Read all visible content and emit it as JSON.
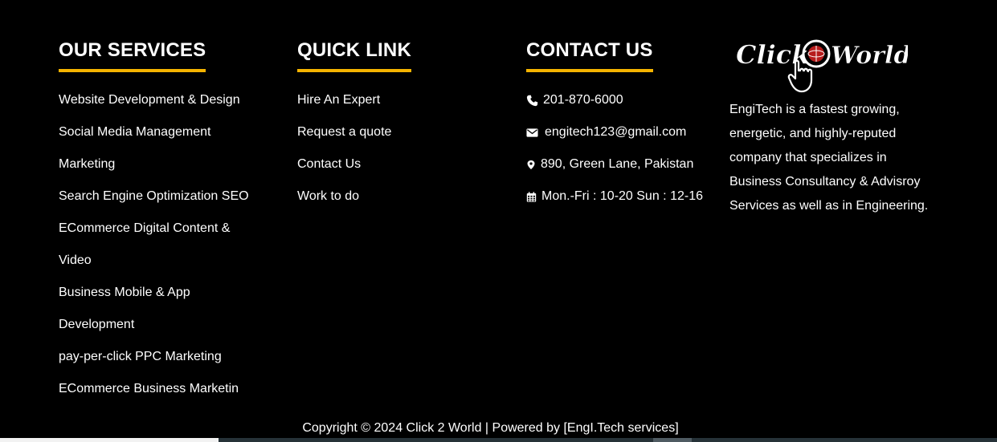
{
  "accent_color": "#f5b400",
  "background_color": "#000000",
  "services": {
    "heading": "OUR SERVICES",
    "items": [
      "Website Development & Design",
      "Social Media Management",
      "Marketing",
      "Search Engine Optimization SEO",
      "ECommerce Digital Content &",
      "Video",
      "Business Mobile & App",
      "Development",
      "pay-per-click PPC Marketing",
      "ECommerce Business Marketin"
    ]
  },
  "quick_links": {
    "heading": "QUICK LINK",
    "items": [
      "Hire An Expert",
      "Request a quote",
      "Contact Us",
      "Work to do"
    ]
  },
  "contact": {
    "heading": "CONTACT US",
    "phone": {
      "icon": "phone-icon",
      "text": "201-870-6000"
    },
    "email": {
      "icon": "envelope-icon",
      "text": "engitech123@gmail.com"
    },
    "address": {
      "icon": "map-marker-icon",
      "text": "890, Green Lane, Pakistan"
    },
    "hours": {
      "icon": "calendar-icon",
      "text": "Mon.-Fri : 10-20 Sun : 12-16"
    }
  },
  "about": {
    "logo_text": "Click 2 World",
    "description": "EngiTech is a fastest growing, energetic, and highly-reputed company that specializes in Business Consultancy & Advisroy Services as well as in Engineering."
  },
  "footer": {
    "copyright": "Copyright © 2024 Click 2 World | Powered by [EngI.Tech services]"
  }
}
